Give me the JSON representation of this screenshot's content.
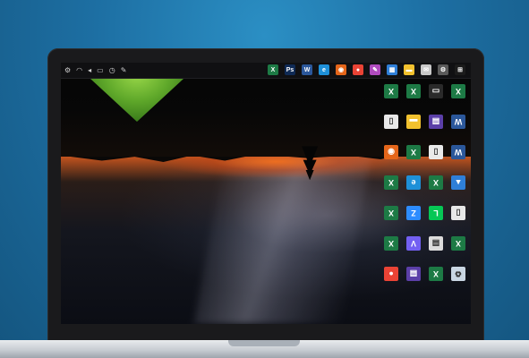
{
  "taskbar": {
    "tray_icons": [
      "settings-icon",
      "network-icon",
      "volume-icon",
      "battery-icon",
      "clock-icon",
      "pen-icon"
    ],
    "apps": [
      {
        "name": "excel-taskbar-icon",
        "color": "#1d7a45",
        "glyph": "X"
      },
      {
        "name": "photoshop-taskbar-icon",
        "color": "#0f2a55",
        "glyph": "Ps"
      },
      {
        "name": "word-taskbar-icon",
        "color": "#2b579a",
        "glyph": "W"
      },
      {
        "name": "edge-taskbar-icon",
        "color": "#1e90d8",
        "glyph": "e"
      },
      {
        "name": "firefox-taskbar-icon",
        "color": "#e5661a",
        "glyph": "◉"
      },
      {
        "name": "chrome-taskbar-icon",
        "color": "#ea4335",
        "glyph": "●"
      },
      {
        "name": "paint-taskbar-icon",
        "color": "#b04bbf",
        "glyph": "✎"
      },
      {
        "name": "store-taskbar-icon",
        "color": "#2f7fd8",
        "glyph": "▦"
      },
      {
        "name": "explorer-taskbar-icon",
        "color": "#f2c12e",
        "glyph": "▬"
      },
      {
        "name": "mail-taskbar-icon",
        "color": "#c9c9c9",
        "glyph": "✉"
      },
      {
        "name": "settings-taskbar-icon",
        "color": "#5a5a5a",
        "glyph": "⚙"
      },
      {
        "name": "start-taskbar-icon",
        "color": "#1b1b1b",
        "glyph": "⊞"
      }
    ]
  },
  "desktop_icons": [
    {
      "name": "desktop-icon-excel-1",
      "color": "#1d7a45",
      "glyph": "X"
    },
    {
      "name": "desktop-icon-excel-2",
      "color": "#1d7a45",
      "glyph": "X"
    },
    {
      "name": "desktop-icon-video",
      "color": "#2a2a2a",
      "glyph": "▭"
    },
    {
      "name": "desktop-icon-excel-3",
      "color": "#1d7a45",
      "glyph": "X"
    },
    {
      "name": "desktop-icon-doc",
      "color": "#e8e8e8",
      "glyph": "▯"
    },
    {
      "name": "desktop-icon-folder",
      "color": "#f2c12e",
      "glyph": "▬"
    },
    {
      "name": "desktop-icon-media",
      "color": "#5b3fa8",
      "glyph": "▤"
    },
    {
      "name": "desktop-icon-word",
      "color": "#2b579a",
      "glyph": "W"
    },
    {
      "name": "desktop-icon-firefox",
      "color": "#e5661a",
      "glyph": "◉"
    },
    {
      "name": "desktop-icon-excel-4",
      "color": "#1d7a45",
      "glyph": "X"
    },
    {
      "name": "desktop-icon-blank",
      "color": "#eaeaea",
      "glyph": "▯"
    },
    {
      "name": "desktop-icon-word-2",
      "color": "#2b579a",
      "glyph": "W"
    },
    {
      "name": "desktop-icon-excel-5",
      "color": "#1d7a45",
      "glyph": "X"
    },
    {
      "name": "desktop-icon-edge",
      "color": "#1e90d8",
      "glyph": "e"
    },
    {
      "name": "desktop-icon-excel-6",
      "color": "#1d7a45",
      "glyph": "X"
    },
    {
      "name": "desktop-icon-vpn",
      "color": "#2f7fd8",
      "glyph": "▲"
    },
    {
      "name": "desktop-icon-excel-7",
      "color": "#1d7a45",
      "glyph": "X"
    },
    {
      "name": "desktop-icon-zoom",
      "color": "#2d8cff",
      "glyph": "Z"
    },
    {
      "name": "desktop-icon-line",
      "color": "#06c755",
      "glyph": "L"
    },
    {
      "name": "desktop-icon-file",
      "color": "#e8e8e8",
      "glyph": "▯"
    },
    {
      "name": "desktop-icon-excel-8",
      "color": "#1d7a45",
      "glyph": "X"
    },
    {
      "name": "desktop-icon-viber",
      "color": "#7360f2",
      "glyph": "V"
    },
    {
      "name": "desktop-icon-notepad",
      "color": "#dcdcdc",
      "glyph": "▤"
    },
    {
      "name": "desktop-icon-excel-9",
      "color": "#1d7a45",
      "glyph": "X"
    },
    {
      "name": "desktop-icon-chrome",
      "color": "#ea4335",
      "glyph": "●"
    },
    {
      "name": "desktop-icon-media-2",
      "color": "#5b3fa8",
      "glyph": "▤"
    },
    {
      "name": "desktop-icon-excel-10",
      "color": "#1d7a45",
      "glyph": "X"
    },
    {
      "name": "desktop-icon-recycle",
      "color": "#c9d6e3",
      "glyph": "♻"
    }
  ]
}
